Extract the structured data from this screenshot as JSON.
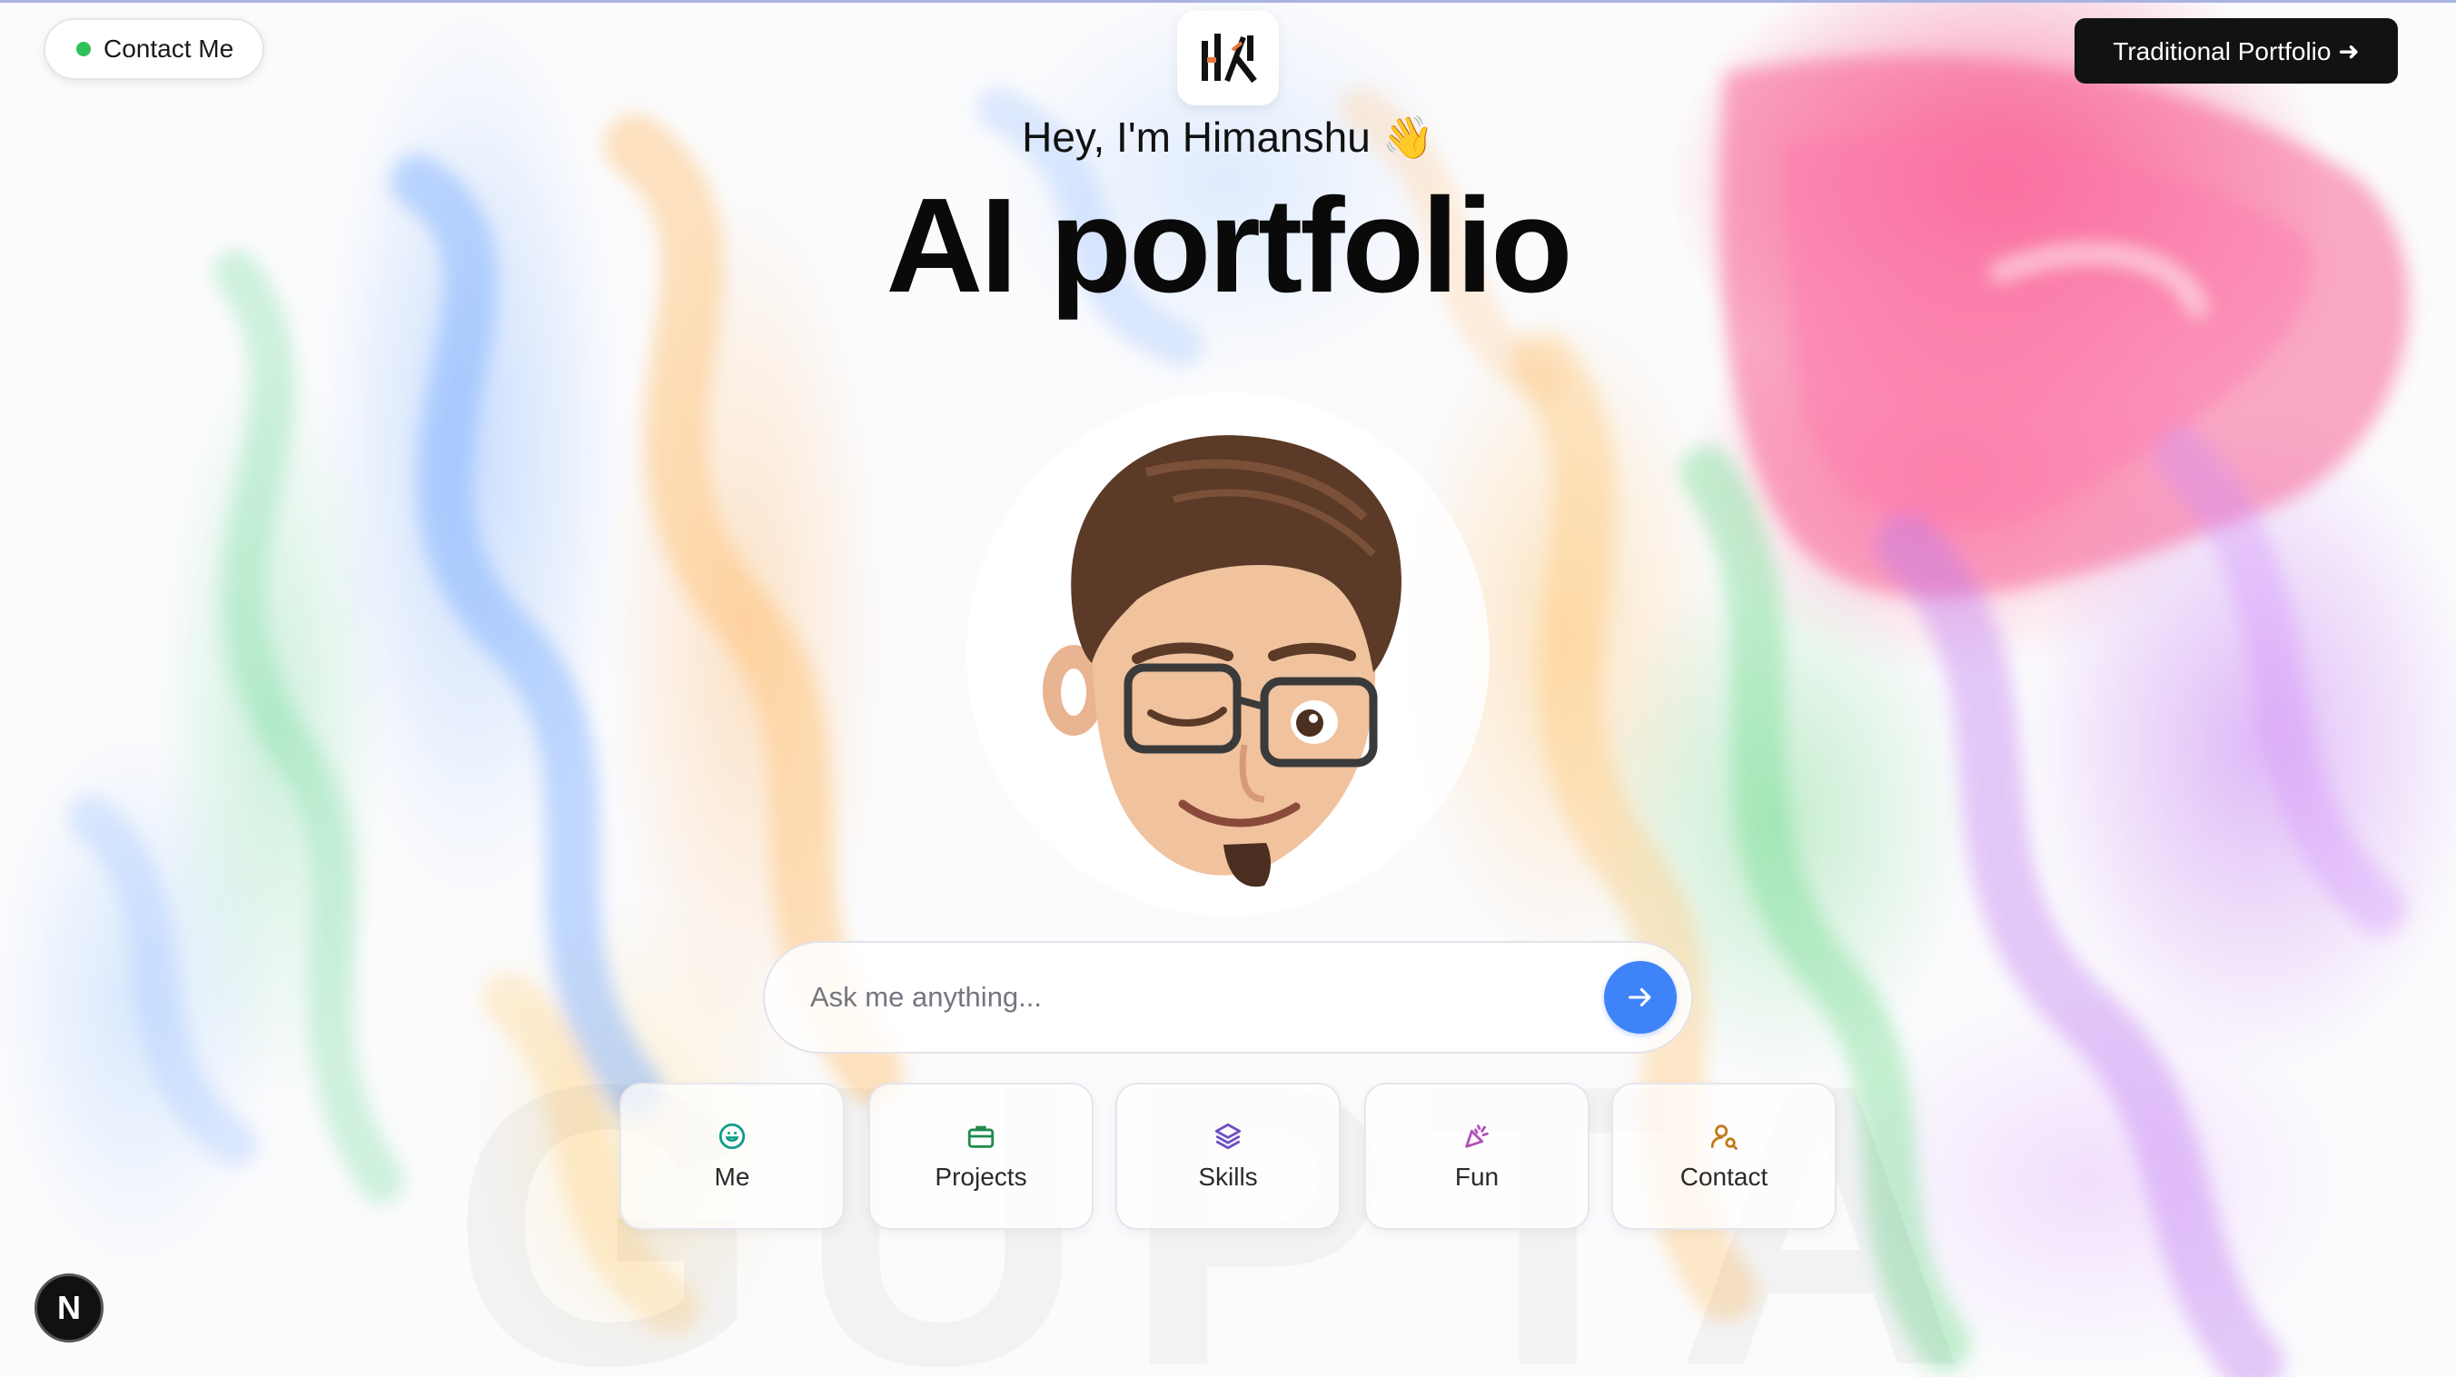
{
  "header": {
    "contact_label": "Contact Me",
    "status_color": "#2fc15a",
    "logo_icon": "hk-monogram-logo",
    "traditional_label": "Traditional Portfolio ➜"
  },
  "hero": {
    "greeting": "Hey, I'm Himanshu 👋",
    "title": "AI portfolio",
    "avatar_icon": "memoji-winking-avatar"
  },
  "chat": {
    "placeholder": "Ask me anything...",
    "send_icon": "arrow-right-icon",
    "accent": "#3f83f8"
  },
  "quick_actions": [
    {
      "label": "Me",
      "icon": "smile-face-icon",
      "color": "#0f9d8a"
    },
    {
      "label": "Projects",
      "icon": "briefcase-icon",
      "color": "#1f8a4c"
    },
    {
      "label": "Skills",
      "icon": "layers-icon",
      "color": "#6d4fc4"
    },
    {
      "label": "Fun",
      "icon": "party-popper-icon",
      "color": "#b24fb8"
    },
    {
      "label": "Contact",
      "icon": "user-search-icon",
      "color": "#c27a1a"
    }
  ],
  "watermark": "GUPTA",
  "dev_badge": "N"
}
